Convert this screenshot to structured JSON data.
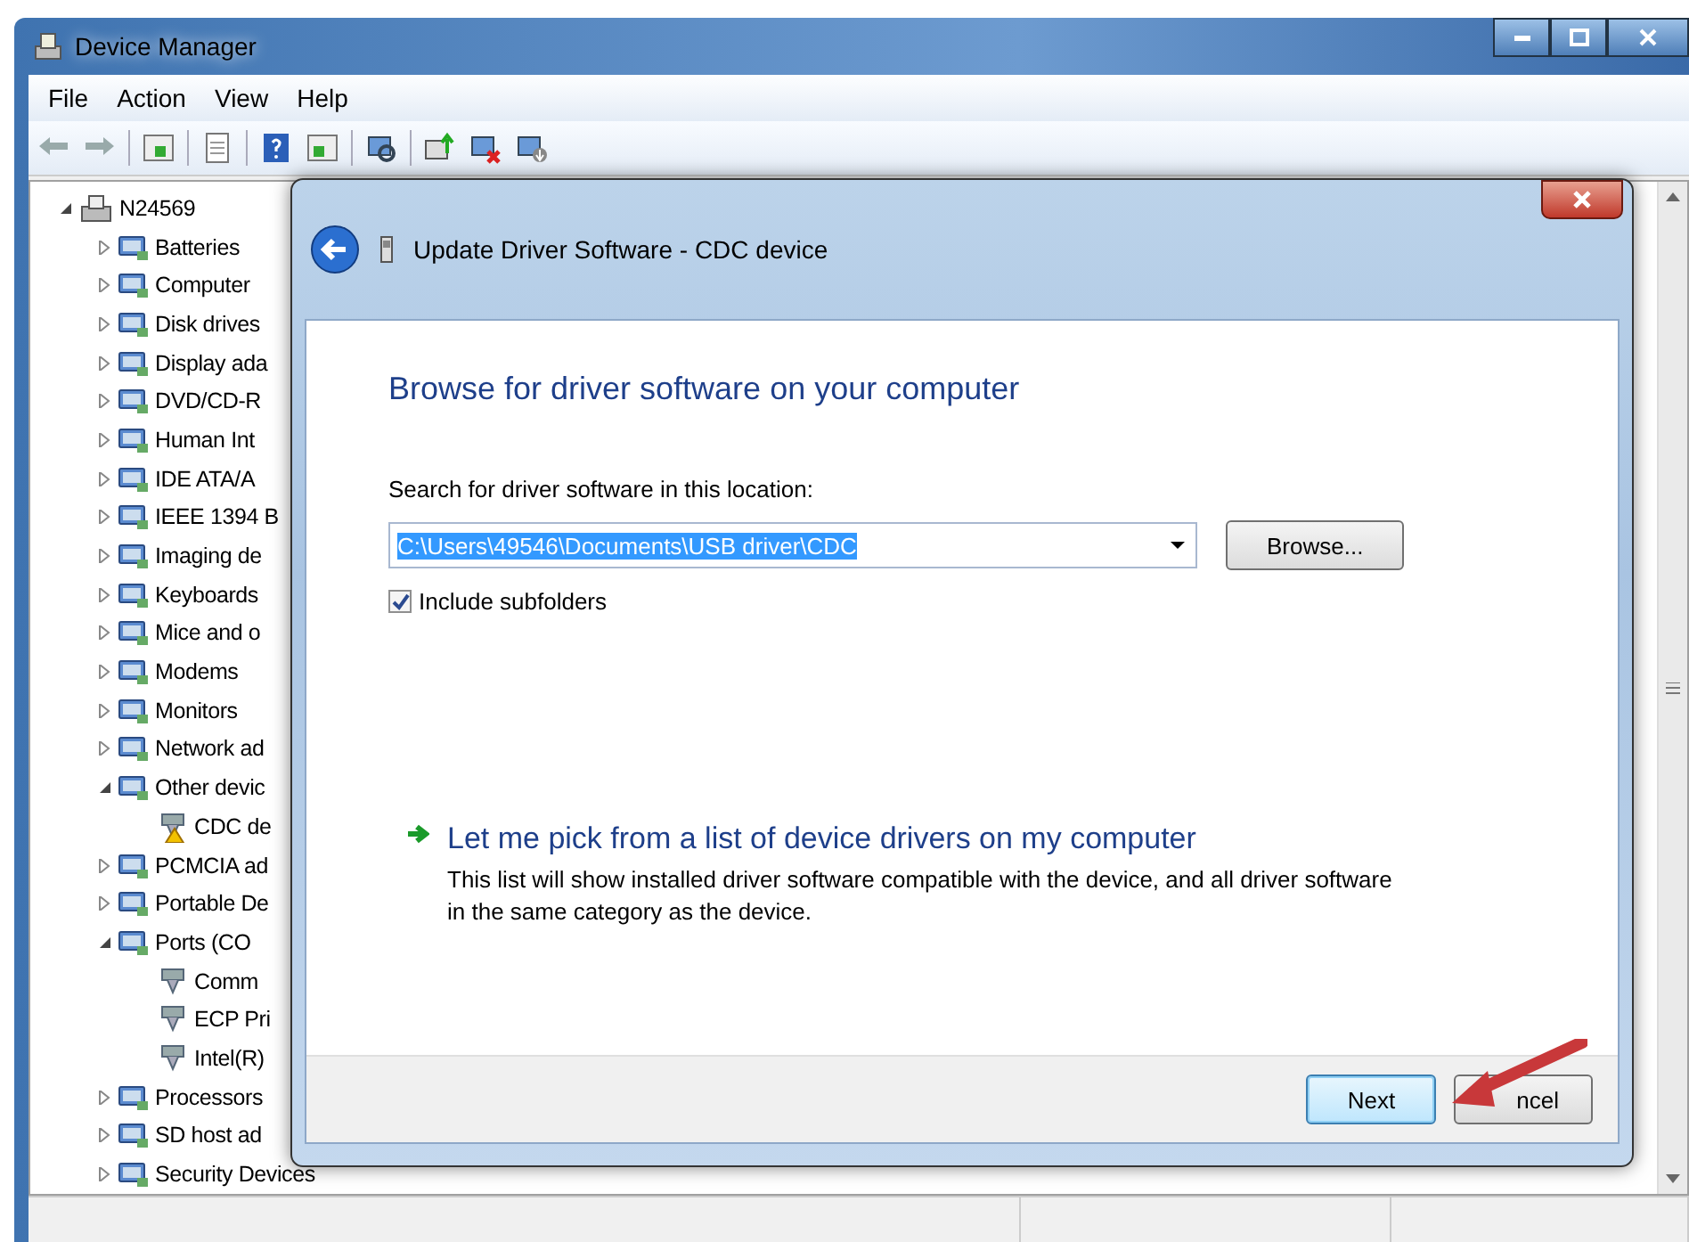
{
  "window": {
    "title": "Device Manager"
  },
  "menu": [
    {
      "label": "File"
    },
    {
      "label": "Action"
    },
    {
      "label": "View"
    },
    {
      "label": "Help"
    }
  ],
  "tree": {
    "label": "N24569",
    "expanded": true,
    "children": [
      {
        "label": "Batteries",
        "expanded": false
      },
      {
        "label": "Computer",
        "expanded": false
      },
      {
        "label": "Disk drives",
        "expanded": false
      },
      {
        "label": "Display ada",
        "expanded": false
      },
      {
        "label": "DVD/CD-R",
        "expanded": false
      },
      {
        "label": "Human Int",
        "expanded": false
      },
      {
        "label": "IDE ATA/A",
        "expanded": false
      },
      {
        "label": "IEEE 1394 B",
        "expanded": false
      },
      {
        "label": "Imaging de",
        "expanded": false
      },
      {
        "label": "Keyboards",
        "expanded": false
      },
      {
        "label": "Mice and o",
        "expanded": false
      },
      {
        "label": "Modems",
        "expanded": false
      },
      {
        "label": "Monitors",
        "expanded": false
      },
      {
        "label": "Network ad",
        "expanded": false
      },
      {
        "label": "Other devic",
        "expanded": true,
        "children": [
          {
            "label": "CDC de",
            "warning": true
          }
        ]
      },
      {
        "label": "PCMCIA ad",
        "expanded": false
      },
      {
        "label": "Portable De",
        "expanded": false
      },
      {
        "label": "Ports (CO",
        "expanded": true,
        "children": [
          {
            "label": "Comm",
            "warning": false
          },
          {
            "label": "ECP Pri",
            "warning": false
          },
          {
            "label": "Intel(R)",
            "warning": false
          }
        ]
      },
      {
        "label": "Processors",
        "expanded": false
      },
      {
        "label": "SD host ad",
        "expanded": false
      },
      {
        "label": "Security Devices",
        "expanded": false
      }
    ]
  },
  "dialog": {
    "title": "Update Driver Software - CDC device",
    "heading": "Browse for driver software on your computer",
    "search_label": "Search for driver software in this location:",
    "path": {
      "value": "C:\\Users\\49546\\Documents\\USB driver\\CDC",
      "selected": true
    },
    "browse_button": "Browse...",
    "include_subfolders": {
      "label": "Include subfolders",
      "checked": true
    },
    "option": {
      "title": "Let me pick from a list of device drivers on my computer",
      "description": "This list will show installed driver software compatible with the device, and all driver software in the same category as the device."
    },
    "buttons": [
      {
        "label": "Next",
        "default": true
      },
      {
        "label": "ncel",
        "default": false
      }
    ]
  }
}
